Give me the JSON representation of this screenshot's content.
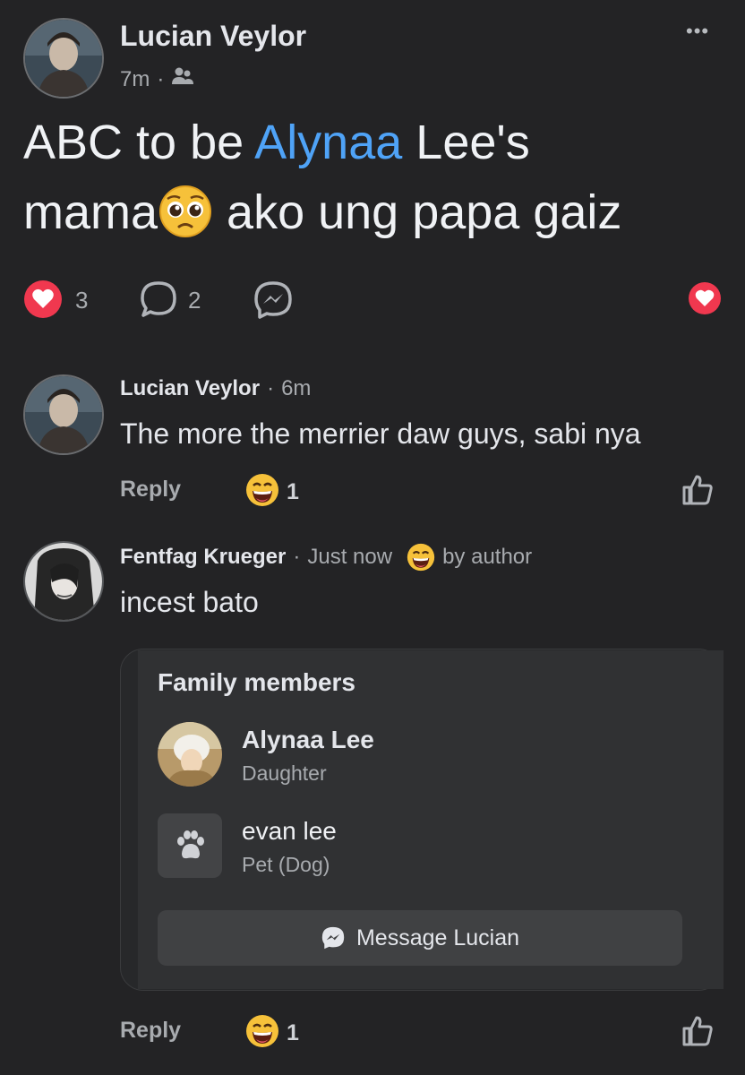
{
  "post": {
    "author": "Lucian Veylor",
    "time": "7m",
    "separator": "·",
    "text_before": "ABC to be ",
    "mention": "Alynaa",
    "text_mid": " Lee's",
    "text_line2_a": "mama",
    "text_line2_b": " ako ung papa gaiz",
    "reactions_count": "3",
    "comments_count": "2",
    "more_label": "•••",
    "audience_icon": "friends-icon"
  },
  "comments": [
    {
      "author": "Lucian Veylor",
      "time": "6m",
      "text": "The more the merrier daw guys, sabi nya",
      "reply_label": "Reply",
      "reaction_count": "1"
    },
    {
      "author": "Fentfag Krueger",
      "time": "Just now",
      "badge": "by author",
      "text": "incest bato",
      "reply_label": "Reply",
      "reaction_count": "1"
    }
  ],
  "family_card": {
    "title": "Family members",
    "members": [
      {
        "name": "Alynaa Lee",
        "relation": "Daughter"
      },
      {
        "name": "evan lee",
        "relation": "Pet (Dog)"
      }
    ],
    "button_label": "Message Lucian"
  },
  "colors": {
    "background": "#232325",
    "mention": "#4fa3f7",
    "heart": "#f0384f"
  }
}
